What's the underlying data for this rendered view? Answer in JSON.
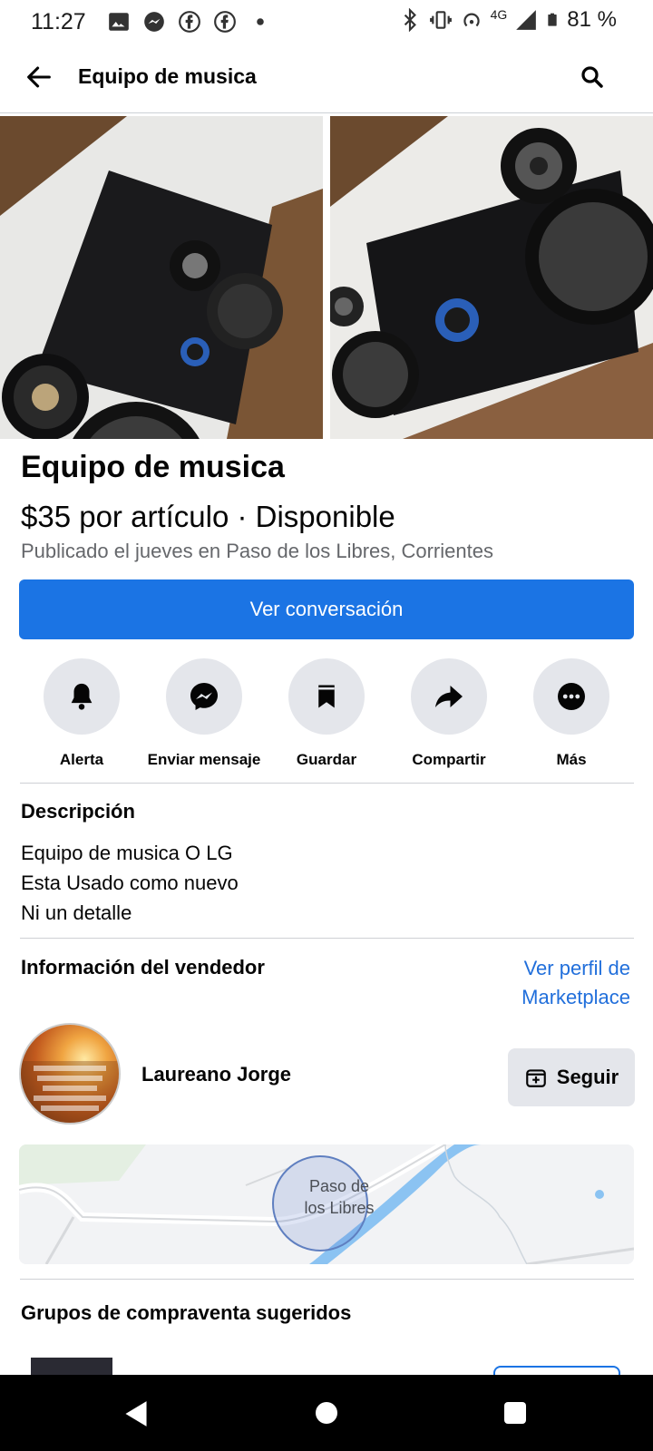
{
  "status_bar": {
    "time": "11:27",
    "network": "4G",
    "battery": "81 %"
  },
  "header": {
    "title": "Equipo de musica"
  },
  "listing": {
    "title": "Equipo de musica",
    "price_status": "$35 por artículo · Disponible",
    "published": "Publicado el jueves en Paso de los Libres, Corrientes",
    "cta": "Ver conversación"
  },
  "actions": [
    {
      "label": "Alerta",
      "icon": "bell-icon"
    },
    {
      "label": "Enviar mensaje",
      "icon": "messenger-icon"
    },
    {
      "label": "Guardar",
      "icon": "bookmark-icon"
    },
    {
      "label": "Compartir",
      "icon": "share-icon"
    },
    {
      "label": "Más",
      "icon": "more-icon"
    }
  ],
  "description": {
    "heading": "Descripción",
    "lines": [
      "Equipo de musica O LG",
      "Esta Usado como nuevo",
      "Ni un detalle"
    ]
  },
  "seller": {
    "heading": "Información del vendedor",
    "profile_link_line1": "Ver perfil de",
    "profile_link_line2": "Marketplace",
    "name": "Laureano Jorge",
    "follow": "Seguir"
  },
  "map": {
    "label_line1": "Paso de",
    "label_line2": "los Libres"
  },
  "groups": {
    "heading": "Grupos de compraventa sugeridos"
  },
  "colors": {
    "primary": "#1b74e4",
    "link": "#216fdb",
    "secondary_text": "#65676b",
    "button_bg": "#e4e6eb"
  }
}
